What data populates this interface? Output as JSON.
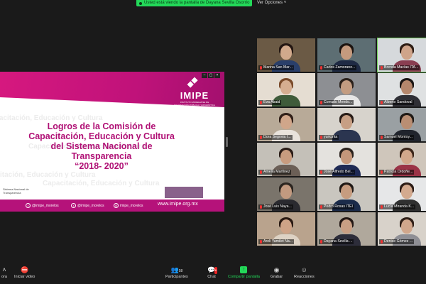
{
  "banner": {
    "text": "Usted está viendo la pantalla de Dayana Sevilla Osorrio",
    "view_options": "Ver Opciones ˅"
  },
  "slide": {
    "logo_name": "IMIPE",
    "logo_sub": "INSTITUTO MORELENSE DE INFORMACIÓN PÚBLICA Y ESTADÍSTICA",
    "title_lines": [
      "Logros de la Comisión de",
      "Capacitación, Educación y Cultura",
      "del Sistema Nacional de",
      "Transparencia",
      "“2018- 2020”"
    ],
    "snt": "Sistema Nacional de Transparencia",
    "watermark": "Capacitación, Educación y Cultura",
    "footer": {
      "fb": "@imipe_morelos",
      "tw": "@imipe_morelos",
      "ig": "imipe_morelos",
      "url": "www.imipe.org.mx"
    }
  },
  "participants": [
    {
      "name": "Marina San Mar...",
      "bg": "#6b5a45",
      "skin": "#d1a98c",
      "hair": "#231612",
      "shirt": "#2a3f6a"
    },
    {
      "name": "Carlos Zamorano...",
      "bg": "#5d6e73",
      "skin": "#c49a7e",
      "hair": "#1c1410",
      "shirt": "#1f2a44"
    },
    {
      "name": "Brenda Macías ITA...",
      "bg": "#d6d9dc",
      "skin": "#cfa48a",
      "hair": "#2e1d15",
      "shirt": "#8a3e51"
    },
    {
      "name": "Eva Abaid",
      "bg": "#e5ddd2",
      "skin": "#d5ad90",
      "hair": "#7a4a2a",
      "shirt": "#3f5b3a"
    },
    {
      "name": "Corrado Mendo...",
      "bg": "#8d8f93",
      "skin": "#c39c81",
      "hair": "#2a201a",
      "shirt": "#e6e6e6"
    },
    {
      "name": "Alberto Sandoval",
      "bg": "#dfe1e2",
      "skin": "#b5876c",
      "hair": "#1b1614",
      "shirt": "#2f2f35"
    },
    {
      "name": "Dora Segovia I...",
      "bg": "#b8aa98",
      "skin": "#d0a68a",
      "hair": "#301f18",
      "shirt": "#e9e3dc"
    },
    {
      "name": "yuricinta",
      "bg": "#d7d3cc",
      "skin": "#c79f84",
      "hair": "#281c17",
      "shirt": "#2b3550"
    },
    {
      "name": "Samuel Montoy...",
      "bg": "#9aa0a3",
      "skin": "#b98e73",
      "hair": "#1f1915",
      "shirt": "#20242c"
    },
    {
      "name": "Amelia Martínez",
      "bg": "#c4c0b8",
      "skin": "#c89c7f",
      "hair": "#2a1c16",
      "shirt": "#6b5f56"
    },
    {
      "name": "José Alfredo Bel...",
      "bg": "#e4e2de",
      "skin": "#c4977b",
      "hair": "#2a221d",
      "shirt": "#1e2a55"
    },
    {
      "name": "Patricia Ordoñe...",
      "bg": "#cfc6bb",
      "skin": "#d2a88c",
      "hair": "#3a2519",
      "shirt": "#9b3347"
    },
    {
      "name": "José Luis Naya...",
      "bg": "#7a746b",
      "skin": "#c29a80",
      "hair": "#2b2520",
      "shirt": "#2a2a2f"
    },
    {
      "name": "Pedro Rosas ITEI",
      "bg": "#c9c6bf",
      "skin": "#c69c7f",
      "hair": "#1f1915",
      "shirt": "#1b2b4a"
    },
    {
      "name": "Lucía Miranda K...",
      "bg": "#e6e7e8",
      "skin": "#d3aa8f",
      "hair": "#2c1c16",
      "shirt": "#303030"
    },
    {
      "name": "Areli Yamilet Na...",
      "bg": "#b9a38d",
      "skin": "#cea387",
      "hair": "#2a1a13",
      "shirt": "#ddd2c4"
    },
    {
      "name": "Dayana Sevilla ...",
      "bg": "#b0a89c",
      "skin": "#c99f84",
      "hair": "#231815",
      "shirt": "#2d2d3a"
    },
    {
      "name": "Denise Gómez ...",
      "bg": "#d8d2ca",
      "skin": "#d1a78c",
      "hair": "#2f1f17",
      "shirt": "#8f8f95"
    }
  ],
  "toolbar": {
    "left_label": "ora",
    "video_label": "Iniciar video",
    "participants_label": "Participantes",
    "participants_count": "58",
    "chat_label": "Chat",
    "chat_badge": "6",
    "share_label": "Compartir pantalla",
    "record_label": "Grabar",
    "reactions_label": "Reacciones"
  },
  "colors": {
    "magenta": "#c0127a",
    "green": "#23d959"
  }
}
